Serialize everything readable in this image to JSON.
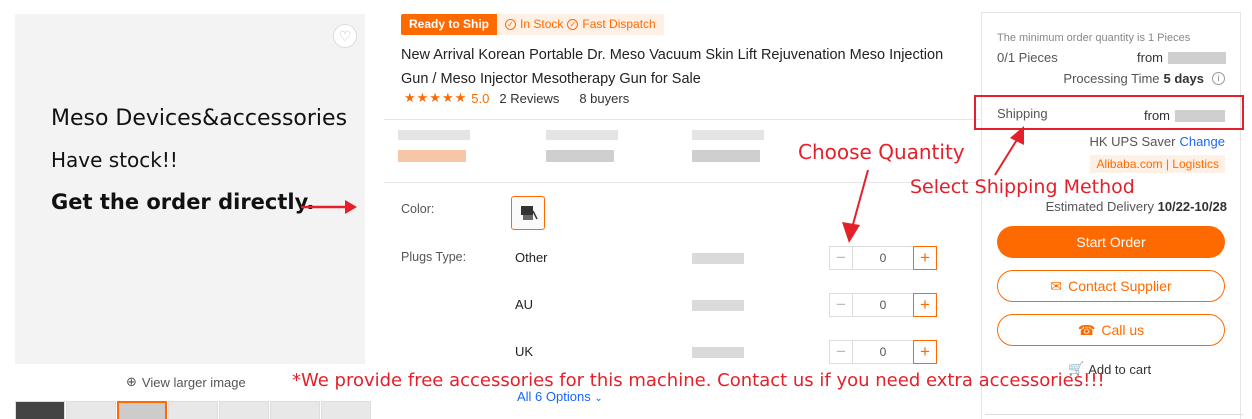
{
  "gallery": {
    "favorite_icon": "heart-icon",
    "promo_line1": "Meso Devices&accessories",
    "promo_line2": "Have stock!!",
    "promo_line3": "Get the order directly.",
    "view_larger": "View larger image",
    "zoom_icon": "zoom-icon"
  },
  "badges": {
    "ready": "Ready to Ship",
    "stock": "In Stock",
    "dispatch": "Fast Dispatch"
  },
  "product": {
    "title": "New Arrival Korean Portable Dr. Meso Vacuum Skin Lift Rejuvenation Meso Injection Gun / Meso Injector Mesotherapy Gun for Sale",
    "rating_value": "5.0",
    "rating_stars": 5,
    "reviews": "2 Reviews",
    "buyers": "8 buyers"
  },
  "options": {
    "color_label": "Color:",
    "plugs_label": "Plugs Type:",
    "plugs": [
      {
        "name": "Other",
        "qty": "0"
      },
      {
        "name": "AU",
        "qty": "0"
      },
      {
        "name": "UK",
        "qty": "0"
      }
    ],
    "all_options": "All 6 Options"
  },
  "annotations": {
    "choose_quantity": "Choose Quantity",
    "select_shipping": "Select Shipping Method",
    "bottom_note": "*We provide free accessories for this machine. Contact us if you need extra accessories!!!"
  },
  "order": {
    "moq": "The minimum order quantity is 1 Pieces",
    "pieces": "0/1 Pieces",
    "from": "from",
    "processing_label": "Processing Time",
    "processing_value": "5 days",
    "shipping_label": "Shipping",
    "carrier": "HK UPS Saver",
    "change": "Change",
    "logistics": "Alibaba.com | Logistics",
    "delivery_label": "Estimated Delivery",
    "delivery_value": "10/22-10/28",
    "start_order": "Start Order",
    "contact_supplier": "Contact Supplier",
    "call_us": "Call us",
    "add_to_cart": "Add to cart"
  },
  "colors": {
    "accent": "#ff6a00",
    "annotation_red": "#e4202a",
    "link_blue": "#1a66ff"
  }
}
